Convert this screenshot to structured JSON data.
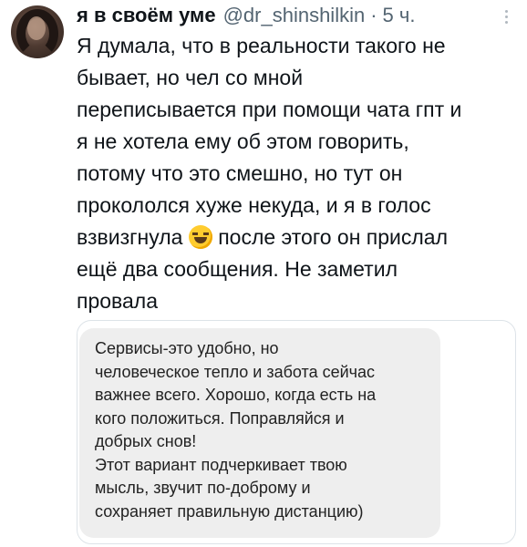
{
  "tweet": {
    "author": {
      "display_name": "я в своём уме",
      "handle": "@dr_shinshilkin",
      "separator": "·",
      "time": "5 ч."
    },
    "more_icon": "more-vertical-icon",
    "text_lines": [
      "Я думала, что в реальности такого не",
      "бывает, но чел со мной",
      "переписывается при помощи чата гпт и",
      "я не хотела ему об этом говорить,",
      "потому что это смешно, но тут он",
      "прокололся хуже некуда, и я в голос",
      "взвизгнула",
      "после этого он прислал",
      "ещё два сообщения. Не заметил",
      "провала"
    ],
    "emoji": "rolling-on-floor-laughing-icon"
  },
  "attached_message": {
    "lines": [
      "Сервисы-это удобно, но",
      "человеческое тепло и забота сейчас",
      "важнее всего. Хорошо, когда есть на",
      "кого положиться. Поправляйся и",
      "добрых снов!",
      "Этот вариант подчеркивает твою",
      "мысль, звучит по-доброму и",
      "сохраняет правильную дистанцию)"
    ]
  }
}
